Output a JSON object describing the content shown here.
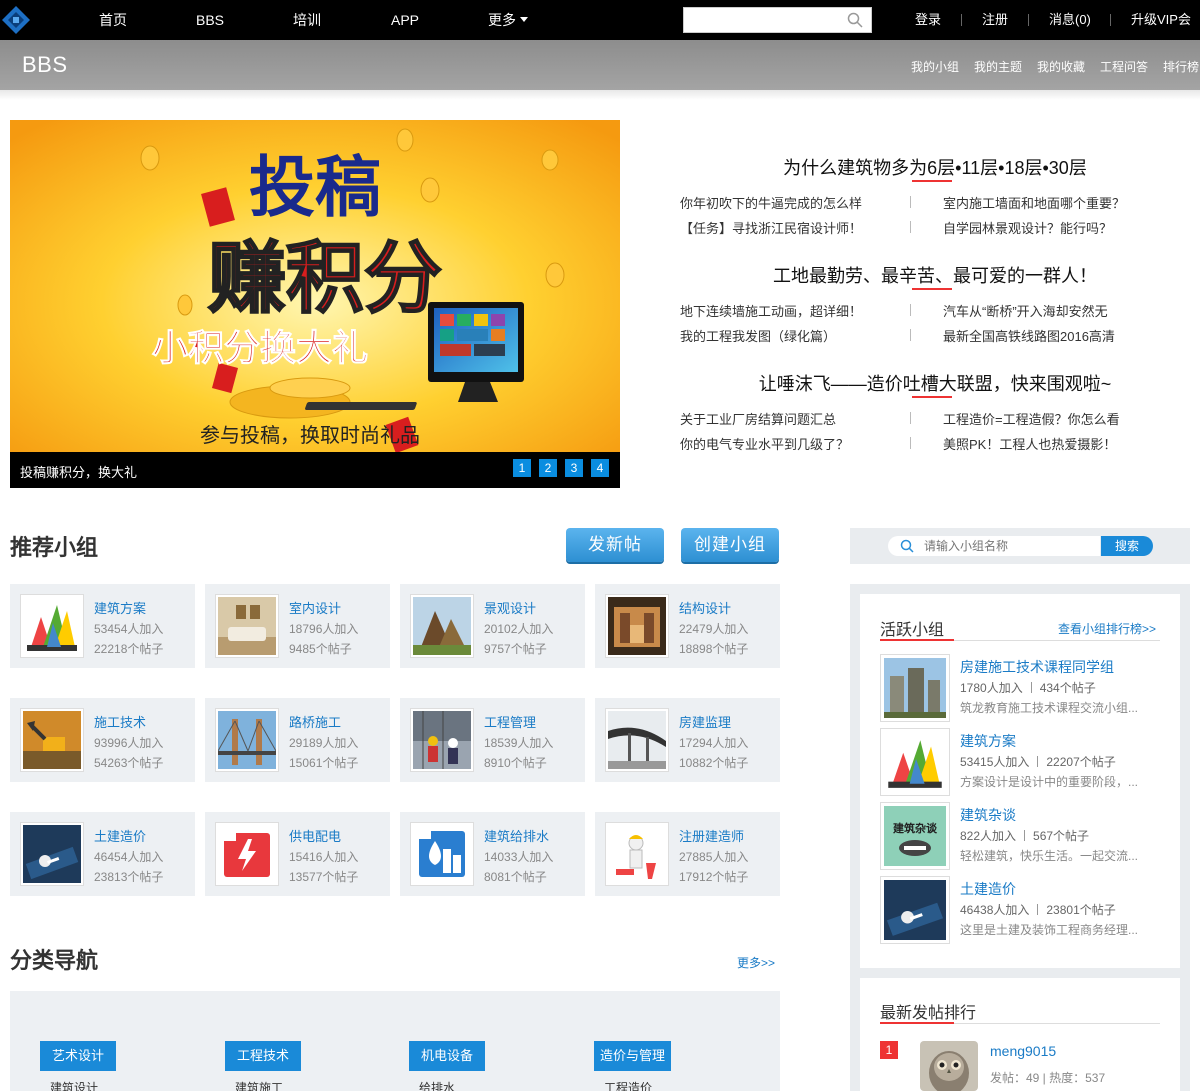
{
  "topnav": {
    "items": [
      "首页",
      "BBS",
      "培训",
      "APP",
      "更多"
    ],
    "search_placeholder": "",
    "login": "登录",
    "register": "注册",
    "messages": "消息(0)",
    "vip": "升级VIP会员"
  },
  "subbar": {
    "title": "BBS",
    "links": [
      "我的小组",
      "我的主题",
      "我的收藏",
      "工程问答",
      "排行榜"
    ]
  },
  "banner": {
    "art_title": "投稿",
    "art_main": "赚积分",
    "art_sub": "小积分换大礼",
    "art_bottom": "参与投稿，换取时尚礼品",
    "caption": "投稿赚积分，换大礼",
    "dots": [
      "1",
      "2",
      "3",
      "4"
    ]
  },
  "topics": [
    {
      "title": "为什么建筑物多为6层•11层•18层•30层",
      "links": [
        "你年初吹下的牛逼完成的怎么样",
        "室内施工墙面和地面哪个重要？",
        "【任务】寻找浙江民宿设计师！",
        "自学园林景观设计？能行吗？"
      ]
    },
    {
      "title": "工地最勤劳、最辛苦、最可爱的一群人！",
      "links": [
        "地下连续墙施工动画，超详细！",
        "汽车从“断桥”开入海却安然无",
        "我的工程我发图（绿化篇）",
        "最新全国高铁线路图2016高清"
      ]
    },
    {
      "title": "让唾沫飞——造价吐槽大联盟，快来围观啦~",
      "links": [
        "关于工业厂房结算问题汇总",
        "工程造价=工程造假？你怎么看",
        "你的电气专业水平到几级了？",
        "美照PK！工程人也热爱摄影！"
      ]
    }
  ],
  "recommend": {
    "title": "推荐小组",
    "new_post": "发新帖",
    "create_group": "创建小组",
    "groups": [
      {
        "name": "建筑方案",
        "members": "53454人加入",
        "posts": "22218个帖子",
        "icon": "building-art-icon"
      },
      {
        "name": "室内设计",
        "members": "18796人加入",
        "posts": "9485个帖子",
        "icon": "interior-icon"
      },
      {
        "name": "景观设计",
        "members": "20102人加入",
        "posts": "9757个帖子",
        "icon": "landscape-icon"
      },
      {
        "name": "结构设计",
        "members": "22479人加入",
        "posts": "18898个帖子",
        "icon": "structure-icon"
      },
      {
        "name": "施工技术",
        "members": "93996人加入",
        "posts": "54263个帖子",
        "icon": "excavator-icon"
      },
      {
        "name": "路桥施工",
        "members": "29189人加入",
        "posts": "15061个帖子",
        "icon": "bridge-icon"
      },
      {
        "name": "工程管理",
        "members": "18539人加入",
        "posts": "8910个帖子",
        "icon": "workers-icon"
      },
      {
        "name": "房建监理",
        "members": "17294人加入",
        "posts": "10882个帖子",
        "icon": "overpass-icon"
      },
      {
        "name": "土建造价",
        "members": "46454人加入",
        "posts": "23813个帖子",
        "icon": "calculator-icon"
      },
      {
        "name": "供电配电",
        "members": "15416人加入",
        "posts": "13577个帖子",
        "icon": "power-icon"
      },
      {
        "name": "建筑给排水",
        "members": "14033人加入",
        "posts": "8081个帖子",
        "icon": "water-icon"
      },
      {
        "name": "注册建造师",
        "members": "27885人加入",
        "posts": "17912个帖子",
        "icon": "builder-icon"
      }
    ]
  },
  "category_nav": {
    "title": "分类导航",
    "more": "更多>>",
    "categories": [
      {
        "tag": "艺术设计",
        "first": "建筑设计"
      },
      {
        "tag": "工程技术",
        "first": "建筑施工"
      },
      {
        "tag": "机电设备",
        "first": "给排水"
      },
      {
        "tag": "造价与管理",
        "first": "工程造价"
      }
    ]
  },
  "right": {
    "search_placeholder": "请输入小组名称",
    "search_btn": "搜索",
    "active": {
      "title": "活跃小组",
      "ranking_link": "查看小组排行榜>>",
      "groups": [
        {
          "name": "房建施工技术课程同学组",
          "members": "1780人加入",
          "posts": "434个帖子",
          "desc": "筑龙教育施工技术课程交流小组..."
        },
        {
          "name": "建筑方案",
          "members": "53415人加入",
          "posts": "22207个帖子",
          "desc": "方案设计是设计中的重要阶段，..."
        },
        {
          "name": "建筑杂谈",
          "members": "822人加入",
          "posts": "567个帖子",
          "desc": "轻松建筑，快乐生活。一起交流...",
          "logo_text": "建筑杂谈"
        },
        {
          "name": "土建造价",
          "members": "46438人加入",
          "posts": "23801个帖子",
          "desc": "这里是土建及装饰工程商务经理..."
        }
      ]
    },
    "latest": {
      "title": "最新发帖排行",
      "rank": "1",
      "user": "meng9015",
      "stats": "发帖：49 | 热度：537"
    }
  },
  "colors": {
    "accent": "#1a8ad8",
    "link": "#1a7bc6",
    "red": "#e33"
  }
}
